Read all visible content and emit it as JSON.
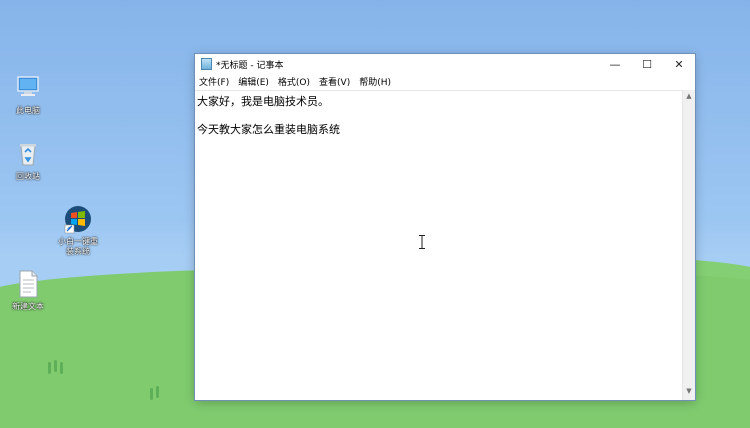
{
  "desktop": {
    "icons": [
      {
        "name": "此电脑",
        "icon": "computer-icon"
      },
      {
        "name": "回收站",
        "icon": "recycle-bin-icon"
      },
      {
        "name": "小白一键重装系统",
        "icon": "installer-icon"
      },
      {
        "name": "新建文本",
        "icon": "text-file-icon"
      }
    ]
  },
  "notepad": {
    "title": "*无标题 - 记事本",
    "controls": {
      "minimize": "—",
      "maximize": "☐",
      "close": "✕"
    },
    "menu": [
      "文件(F)",
      "编辑(E)",
      "格式(O)",
      "查看(V)",
      "帮助(H)"
    ],
    "lines": [
      "大家好，我是电脑技术员。",
      "",
      "今天教大家怎么重装电脑系统"
    ],
    "scroll": {
      "up": "▲",
      "down": "▼"
    }
  },
  "colors": {
    "sky": "#9cc6f2",
    "grass": "#7fcb6e"
  }
}
